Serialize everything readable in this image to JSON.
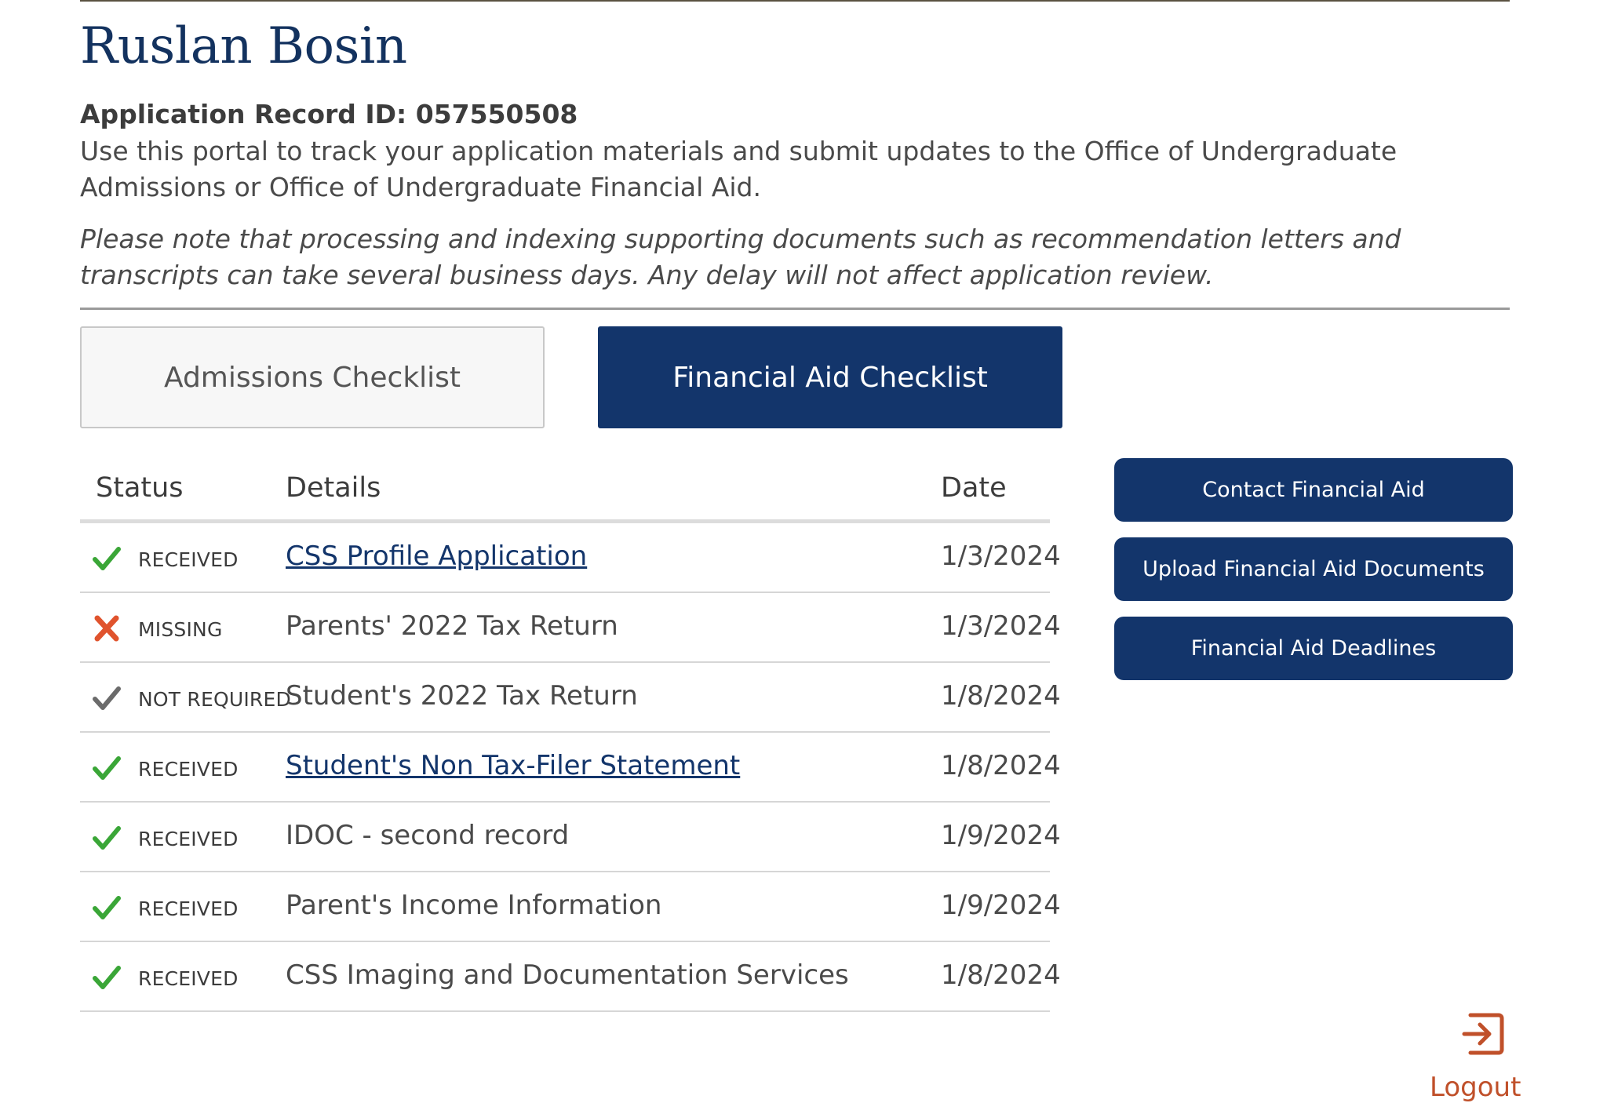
{
  "header": {
    "name": "Ruslan Bosin",
    "record_id": "Application Record ID: 057550508",
    "intro": "Use this portal to track your application materials and submit updates to the Office of Undergraduate Admissions or Office of Undergraduate Financial Aid.",
    "note": "Please note that processing and indexing supporting documents such as recommendation letters and transcripts can take several business days. Any delay will not affect application review."
  },
  "tabs": {
    "admissions": "Admissions Checklist",
    "financial": "Financial Aid Checklist",
    "active": "financial"
  },
  "table": {
    "headers": {
      "status": "Status",
      "details": "Details",
      "date": "Date"
    },
    "rows": [
      {
        "icon": "check-icon",
        "status": "RECEIVED",
        "details": "CSS Profile Application",
        "date": "1/3/2024",
        "link": true
      },
      {
        "icon": "x-icon",
        "status": "MISSING",
        "details": "Parents' 2022 Tax Return",
        "date": "1/3/2024",
        "link": false
      },
      {
        "icon": "gray-check-icon",
        "status": "NOT REQUIRED",
        "details": "Student's 2022 Tax Return",
        "date": "1/8/2024",
        "link": false
      },
      {
        "icon": "check-icon",
        "status": "RECEIVED",
        "details": "Student's Non Tax-Filer Statement",
        "date": "1/8/2024",
        "link": true
      },
      {
        "icon": "check-icon",
        "status": "RECEIVED",
        "details": "IDOC - second record",
        "date": "1/9/2024",
        "link": false
      },
      {
        "icon": "check-icon",
        "status": "RECEIVED",
        "details": "Parent's Income Information",
        "date": "1/9/2024",
        "link": false
      },
      {
        "icon": "check-icon",
        "status": "RECEIVED",
        "details": "CSS Imaging and Documentation Services",
        "date": "1/8/2024",
        "link": false
      }
    ]
  },
  "sidebar": {
    "contact": "Contact Financial Aid",
    "upload": "Upload Financial Aid Documents",
    "deadlines": "Financial Aid Deadlines"
  },
  "logout": {
    "label": "Logout",
    "icon": "logout-icon"
  },
  "colors": {
    "navy": "#13356b",
    "received_green": "#3aa637",
    "missing_red": "#e0532d",
    "not_required_gray": "#6b6b6b",
    "logout_orange": "#c0502a"
  }
}
